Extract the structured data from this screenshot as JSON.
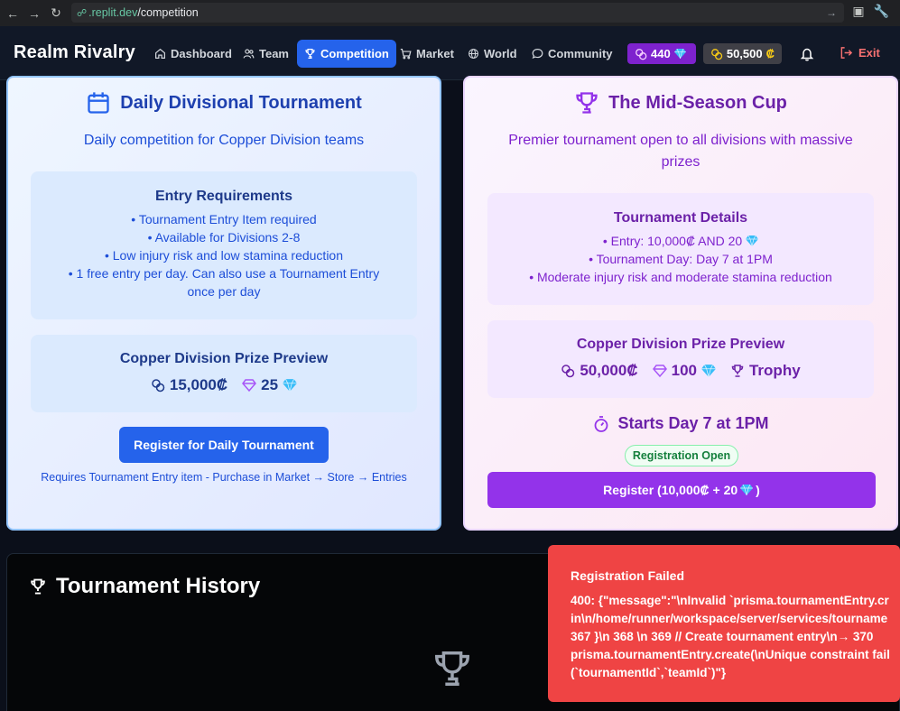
{
  "browser": {
    "url_host": ".replit.dev",
    "url_path": "/competition"
  },
  "nav": {
    "brand": "Realm Rivalry",
    "items": [
      {
        "label": "Dashboard",
        "icon": "home-icon"
      },
      {
        "label": "Team",
        "icon": "users-icon"
      },
      {
        "label": "Competition",
        "icon": "trophy-icon",
        "active": true
      },
      {
        "label": "Market",
        "icon": "cart-icon"
      },
      {
        "label": "World",
        "icon": "globe-icon"
      },
      {
        "label": "Community",
        "icon": "chat-icon"
      }
    ],
    "gems": "440",
    "credits": "50,500",
    "credit_symbol": "₡",
    "exit_label": "Exit"
  },
  "daily": {
    "title": "Daily Divisional Tournament",
    "subtitle": "Daily competition for Copper Division teams",
    "requirements_title": "Entry Requirements",
    "requirements": [
      "• Tournament Entry Item required",
      "• Available for Divisions 2-8",
      "• Low injury risk and low stamina reduction",
      "• 1 free entry per day. Can also use a Tournament Entry once per day"
    ],
    "prize_title": "Copper Division Prize Preview",
    "prize_credits": "15,000₡",
    "prize_gems": "25",
    "register_label": "Register for Daily Tournament",
    "note": "Requires Tournament Entry item - Purchase in Market → Store → Entries"
  },
  "cup": {
    "title": "The Mid-Season Cup",
    "subtitle": "Premier tournament open to all divisions with massive prizes",
    "details_title": "Tournament Details",
    "details": [
      "• Entry: 10,000₡ AND 20",
      "• Tournament Day: Day 7 at 1PM",
      "• Moderate injury risk and moderate stamina reduction"
    ],
    "prize_title": "Copper Division Prize Preview",
    "prize_credits": "50,000₡",
    "prize_gems": "100",
    "prize_trophy": "Trophy",
    "starts": "Starts Day 7 at 1PM",
    "status": "Registration Open",
    "register_label": "Register (10,000₡ + 20",
    "register_close": ")"
  },
  "history": {
    "title": "Tournament History"
  },
  "toast": {
    "title": "Registration Failed",
    "lines": [
      "400: {\"message\":\"\\nInvalid `prisma.tournamentEntry.cr",
      "in\\n/home/runner/workspace/server/services/tourname",
      "367 }\\n 368 \\n 369 // Create tournament entry\\n→ 370",
      "prisma.tournamentEntry.create(\\nUnique constraint fail",
      "(`tournamentId`,`teamId`)\"}"
    ]
  },
  "colors": {
    "primary_blue": "#2563eb",
    "cup_purple": "#9333ea",
    "error_red": "#ef4444",
    "nav_bg": "#111827"
  }
}
